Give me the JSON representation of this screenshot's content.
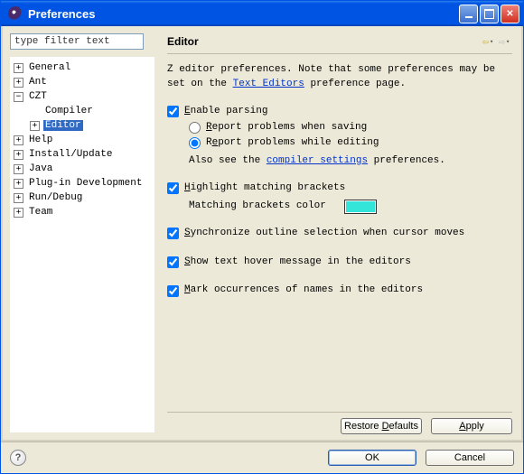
{
  "window": {
    "title": "Preferences"
  },
  "filter": {
    "placeholder": "type filter text"
  },
  "tree": {
    "items": [
      {
        "label": "General",
        "indent": 0,
        "expand": "plus"
      },
      {
        "label": "Ant",
        "indent": 0,
        "expand": "plus"
      },
      {
        "label": "CZT",
        "indent": 0,
        "expand": "minus"
      },
      {
        "label": "Compiler",
        "indent": 1,
        "expand": "blank"
      },
      {
        "label": "Editor",
        "indent": 1,
        "expand": "plus",
        "selected": true
      },
      {
        "label": "Help",
        "indent": 0,
        "expand": "plus"
      },
      {
        "label": "Install/Update",
        "indent": 0,
        "expand": "plus"
      },
      {
        "label": "Java",
        "indent": 0,
        "expand": "plus"
      },
      {
        "label": "Plug-in Development",
        "indent": 0,
        "expand": "plus"
      },
      {
        "label": "Run/Debug",
        "indent": 0,
        "expand": "plus"
      },
      {
        "label": "Team",
        "indent": 0,
        "expand": "plus"
      }
    ]
  },
  "editor": {
    "heading": "Editor",
    "intro_prefix": "Z editor preferences. Note that some preferences may be set on the ",
    "intro_link": "Text Editors",
    "intro_suffix": " preference page.",
    "enable_parsing": {
      "label": "Enable parsing",
      "checked": true,
      "mn": "E"
    },
    "radio_saving": {
      "label": "Report problems when saving",
      "checked": false,
      "mn": "R"
    },
    "radio_editing": {
      "label": "Report problems while editing",
      "checked": true,
      "mn": "e"
    },
    "also_prefix": "Also see the ",
    "also_link": "compiler settings",
    "also_suffix": " preferences.",
    "hl_brackets": {
      "label": "Highlight matching brackets",
      "checked": true,
      "mn": "H"
    },
    "brackets_color_label": "Matching brackets color",
    "brackets_color": "#33e5d9",
    "sync_outline": {
      "label": "Synchronize outline selection when cursor moves",
      "checked": true,
      "mn": "S"
    },
    "hover": {
      "label": "Show text hover message in the editors",
      "checked": true,
      "mn": "S"
    },
    "mark_occ": {
      "label": "Mark occurrences of names in the editors",
      "checked": true,
      "mn": "M"
    }
  },
  "buttons": {
    "restore": "Restore Defaults",
    "apply": "Apply",
    "ok": "OK",
    "cancel": "Cancel"
  }
}
